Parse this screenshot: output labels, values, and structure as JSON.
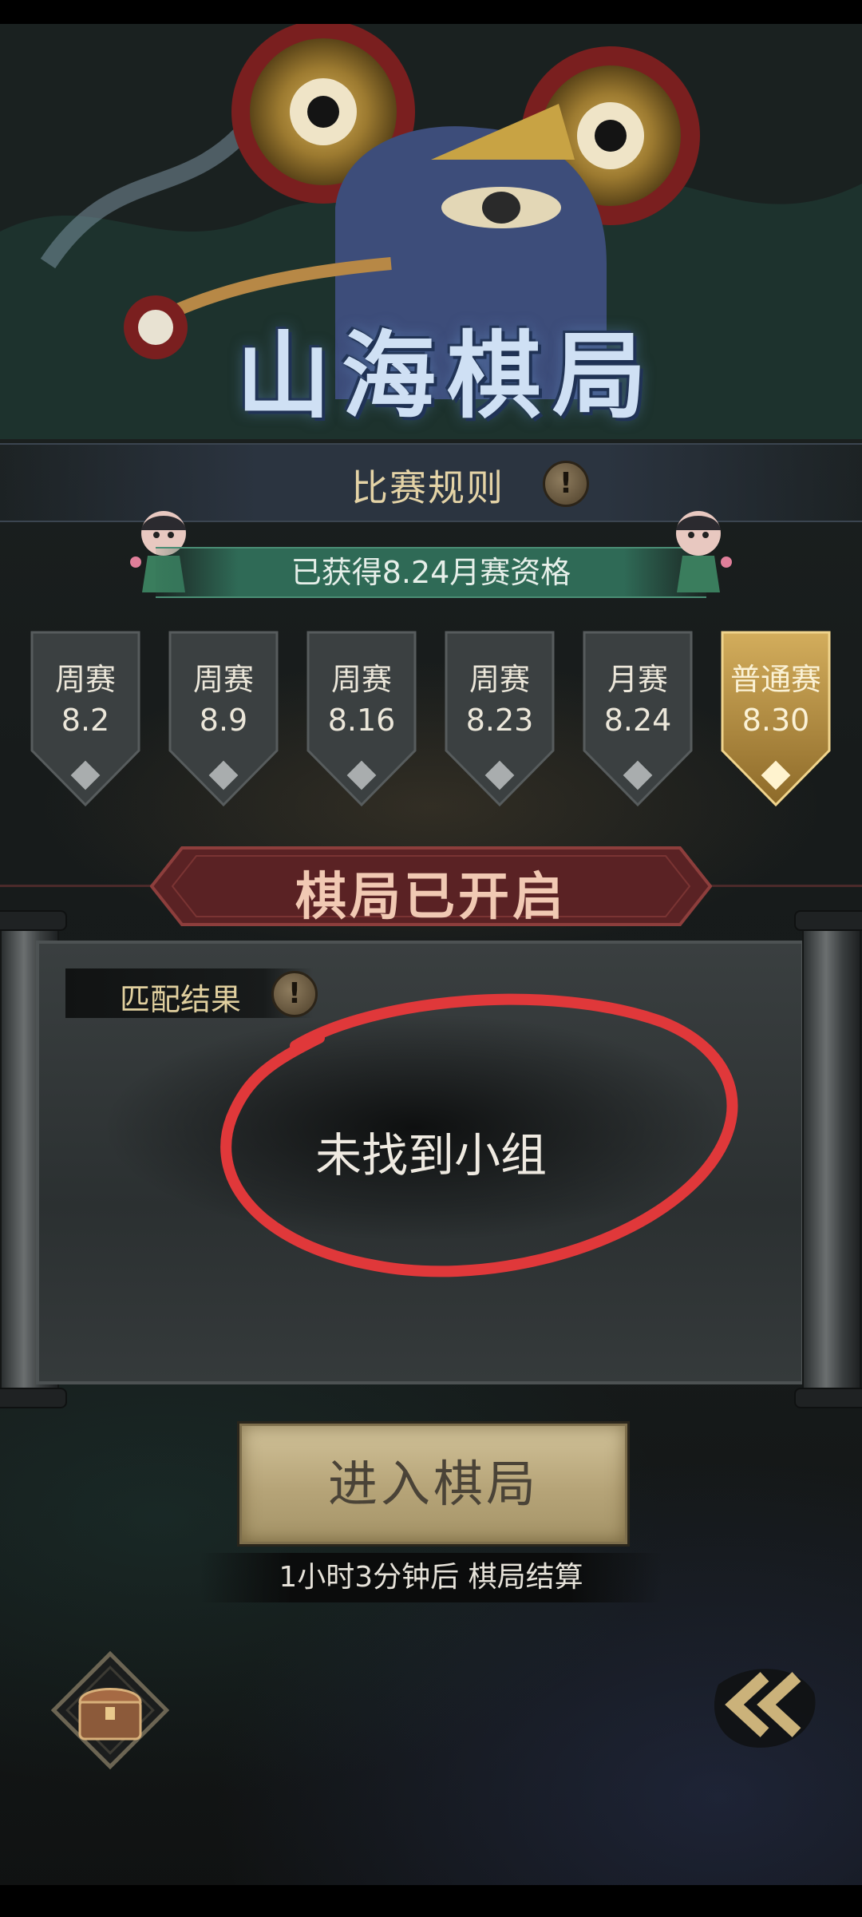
{
  "header": {
    "title": "山海棋局",
    "rules_label": "比赛规则"
  },
  "qualification": {
    "text": "已获得8.24月赛资格"
  },
  "tabs": [
    {
      "type": "周赛",
      "date": "8.2",
      "active": false
    },
    {
      "type": "周赛",
      "date": "8.9",
      "active": false
    },
    {
      "type": "周赛",
      "date": "8.16",
      "active": false
    },
    {
      "type": "周赛",
      "date": "8.23",
      "active": false
    },
    {
      "type": "月赛",
      "date": "8.24",
      "active": false
    },
    {
      "type": "普通赛",
      "date": "8.30",
      "active": true
    }
  ],
  "status": {
    "text": "棋局已开启"
  },
  "match": {
    "label": "匹配结果",
    "result": "未找到小组"
  },
  "actions": {
    "enter_label": "进入棋局",
    "settle_text": "1小时3分钟后 棋局结算"
  },
  "icons": {
    "info": "info-icon",
    "chest": "treasure-chest-icon",
    "back": "double-chevron-left-icon"
  },
  "colors": {
    "accent_gold": "#c7a14f",
    "banner_red": "#5a2224",
    "qualification_green": "#2f6a56",
    "annotation_red": "#e0383a"
  }
}
